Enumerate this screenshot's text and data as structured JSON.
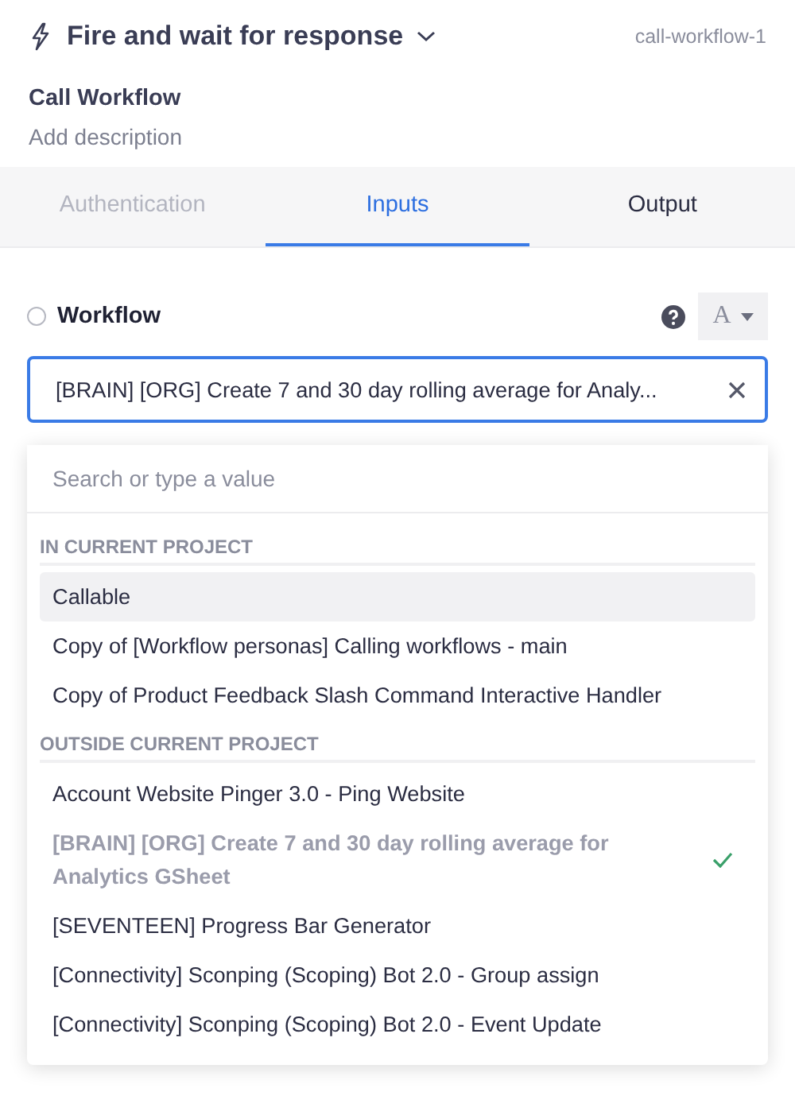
{
  "header": {
    "mode": "Fire and wait for response",
    "step_id": "call-workflow-1"
  },
  "step": {
    "title": "Call Workflow",
    "description_placeholder": "Add description"
  },
  "tabs": [
    {
      "label": "Authentication",
      "selected": false,
      "disabled": true
    },
    {
      "label": "Inputs",
      "selected": true,
      "disabled": false
    },
    {
      "label": "Output",
      "selected": false,
      "disabled": false
    }
  ],
  "field": {
    "label": "Workflow",
    "type_toggle": "A",
    "value": "[BRAIN] [ORG] Create 7 and 30 day rolling average for Analy..."
  },
  "dropdown": {
    "search_placeholder": "Search or type a value",
    "groups": [
      {
        "heading": "IN CURRENT PROJECT",
        "items": [
          {
            "label": "Callable",
            "highlighted": true,
            "selected": false
          },
          {
            "label": "Copy of [Workflow personas] Calling workflows - main",
            "highlighted": false,
            "selected": false
          },
          {
            "label": "Copy of Product Feedback Slash Command Interactive Handler",
            "highlighted": false,
            "selected": false
          }
        ]
      },
      {
        "heading": "OUTSIDE CURRENT PROJECT",
        "items": [
          {
            "label": "Account Website Pinger 3.0 - Ping Website",
            "highlighted": false,
            "selected": false
          },
          {
            "label": "[BRAIN] [ORG] Create 7 and 30 day rolling average for Analytics GSheet",
            "highlighted": false,
            "selected": true
          },
          {
            "label": "[SEVENTEEN] Progress Bar Generator",
            "highlighted": false,
            "selected": false
          },
          {
            "label": "[Connectivity] Sconping (Scoping) Bot 2.0 - Group assign",
            "highlighted": false,
            "selected": false
          },
          {
            "label": "[Connectivity] Sconping (Scoping) Bot 2.0 - Event Update",
            "highlighted": false,
            "selected": false
          }
        ]
      }
    ]
  }
}
